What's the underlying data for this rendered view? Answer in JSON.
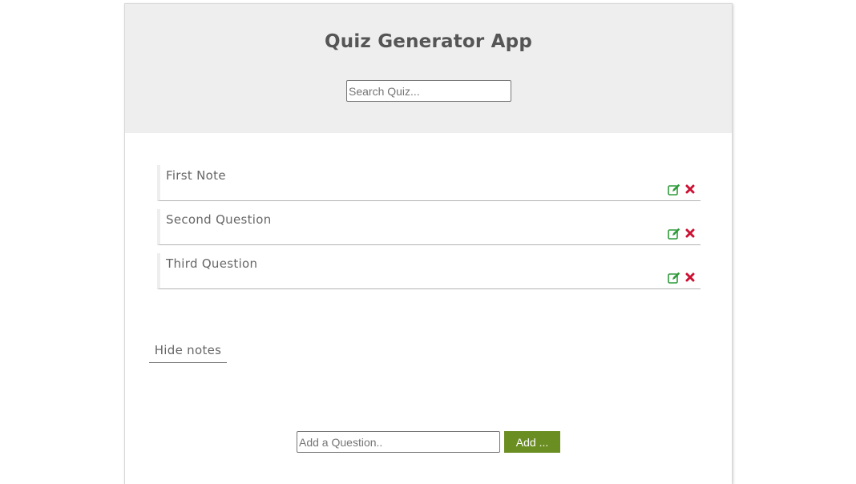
{
  "header": {
    "title": "Quiz Generator App",
    "search_placeholder": "Search Quiz..."
  },
  "notes": [
    {
      "text": "First Note",
      "edit_icon": "edit-icon",
      "delete_icon": "close-icon"
    },
    {
      "text": "Second Question",
      "edit_icon": "edit-icon",
      "delete_icon": "close-icon"
    },
    {
      "text": "Third Question",
      "edit_icon": "edit-icon",
      "delete_icon": "close-icon"
    }
  ],
  "toggle": {
    "label": "Hide notes"
  },
  "add_form": {
    "input_placeholder": "Add a Question..",
    "button_label": "Add ..."
  },
  "colors": {
    "header_bg": "#eeeeee",
    "add_button": "#6b8e23",
    "edit_icon": "#2e9a3a",
    "delete_icon": "#cc1133"
  }
}
